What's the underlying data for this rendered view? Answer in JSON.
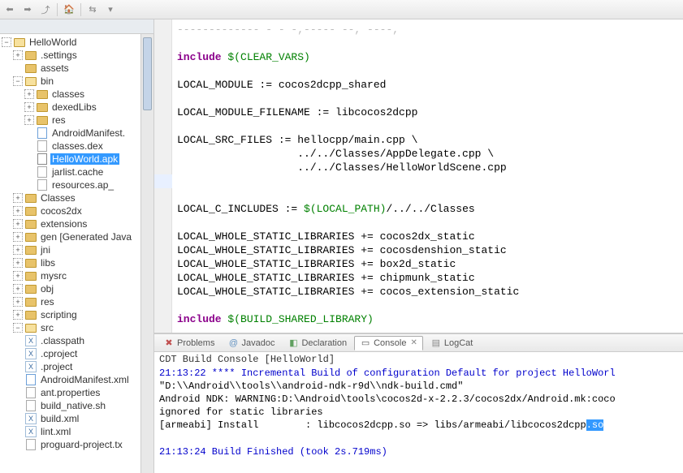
{
  "tree": {
    "root": "HelloWorld",
    "settings": ".settings",
    "assets": "assets",
    "bin": "bin",
    "classes_dir": "classes",
    "dexedLibs": "dexedLibs",
    "res_dir": "res",
    "androidManifest": "AndroidManifest.",
    "classes_dex": "classes.dex",
    "helloworld_apk": "HelloWorld.apk",
    "jarlist": "jarlist.cache",
    "resources_ap": "resources.ap_",
    "Classes": "Classes",
    "cocos2dx": "cocos2dx",
    "extensions": "extensions",
    "gen": "gen [Generated Java",
    "jni": "jni",
    "libs": "libs",
    "mysrc": "mysrc",
    "obj": "obj",
    "res": "res",
    "scripting": "scripting",
    "src": "src",
    "classpath": ".classpath",
    "cproject": ".cproject",
    "project": ".project",
    "androidManifestXml": "AndroidManifest.xml",
    "ant_properties": "ant.properties",
    "build_native": "build_native.sh",
    "build_xml": "build.xml",
    "lint_xml": "lint.xml",
    "proguard": "proguard-project.tx"
  },
  "code": {
    "l0": "------------- - - -,----- --, ----,",
    "l1a": "include",
    "l1b": " $(CLEAR_VARS)",
    "l2": "LOCAL_MODULE := cocos2dcpp_shared",
    "l3": "LOCAL_MODULE_FILENAME := libcocos2dcpp",
    "l4": "LOCAL_SRC_FILES := hellocpp/main.cpp \\",
    "l5": "                   ../../Classes/AppDelegate.cpp \\",
    "l6": "                   ../../Classes/HelloWorldScene.cpp",
    "l7a": "LOCAL_C_INCLUDES := ",
    "l7b": "$(LOCAL_PATH)",
    "l7c": "/../../Classes",
    "l8": "LOCAL_WHOLE_STATIC_LIBRARIES += cocos2dx_static",
    "l9": "LOCAL_WHOLE_STATIC_LIBRARIES += cocosdenshion_static",
    "l10": "LOCAL_WHOLE_STATIC_LIBRARIES += box2d_static",
    "l11": "LOCAL_WHOLE_STATIC_LIBRARIES += chipmunk_static",
    "l12": "LOCAL_WHOLE_STATIC_LIBRARIES += cocos_extension_static",
    "l13a": "include",
    "l13b": " $(BUILD_SHARED_LIBRARY)"
  },
  "tabs": {
    "problems": "Problems",
    "javadoc": "Javadoc",
    "declaration": "Declaration",
    "console": "Console",
    "logcat": "LogCat"
  },
  "console": {
    "title": "CDT Build Console [HelloWorld]",
    "l1": "21:13:22 **** Incremental Build of configuration Default for project HelloWorl",
    "l2": "\"D:\\\\Android\\\\tools\\\\android-ndk-r9d\\\\ndk-build.cmd\"",
    "l3": "Android NDK: WARNING:D:\\Android\\tools\\cocos2d-x-2.2.3/cocos2dx/Android.mk:coco",
    "l4": "ignored for static libraries",
    "l5a": "[armeabi] Install        : libcocos2dcpp.so => libs/armeabi/libcocos2dcpp",
    "l5b": ".so",
    "l6": "21:13:24 Build Finished (took 2s.719ms)"
  }
}
